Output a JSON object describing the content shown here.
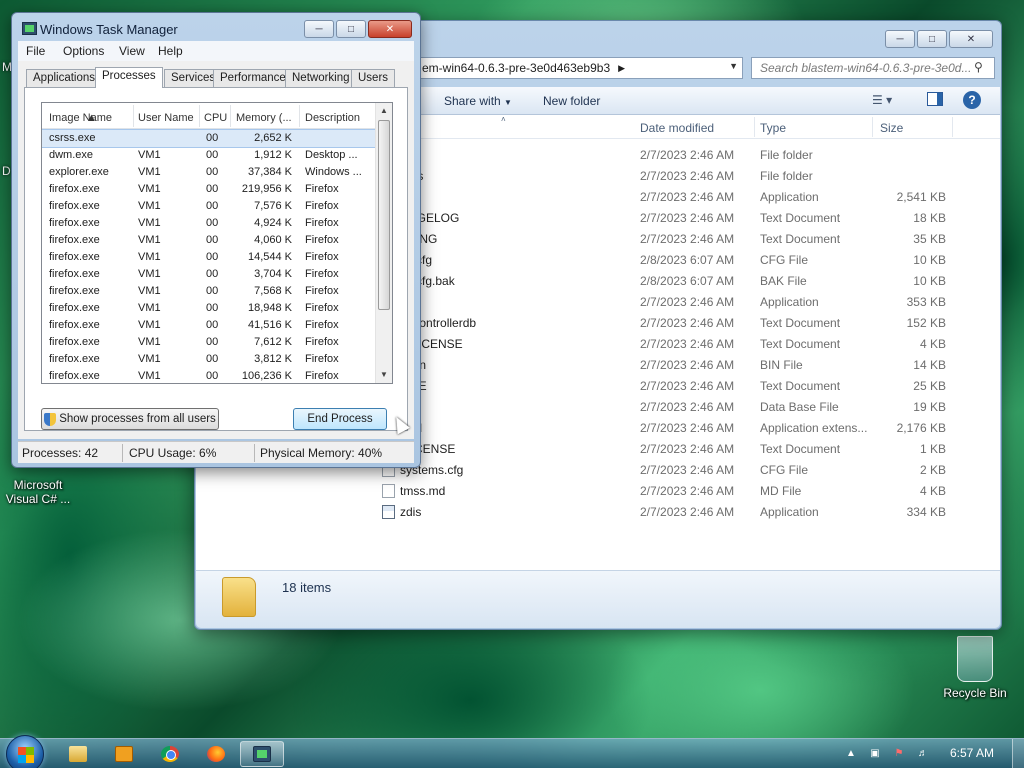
{
  "desktop": {
    "recycle_bin_label": "Recycle Bin",
    "vs_icon_label_line1": "Microsoft",
    "vs_icon_label_line2": "Visual C# ...",
    "edge_label_1": "M",
    "edge_label_2": "D"
  },
  "explorer": {
    "address_text": "em-win64-0.6.3-pre-3e0d463eb9b3",
    "search_placeholder": "Search blastem-win64-0.6.3-pre-3e0d...",
    "toolbar": {
      "share_with": "Share with",
      "new_folder": "New folder"
    },
    "columns": {
      "date": "Date modified",
      "type": "Type",
      "size": "Size"
    },
    "files": [
      {
        "name": "ges",
        "date": "2/7/2023 2:46 AM",
        "type": "File folder",
        "size": ""
      },
      {
        "name": "ders",
        "date": "2/7/2023 2:46 AM",
        "type": "File folder",
        "size": ""
      },
      {
        "name": "tem",
        "date": "2/7/2023 2:46 AM",
        "type": "Application",
        "size": "2,541 KB"
      },
      {
        "name": "ANGELOG",
        "date": "2/7/2023 2:46 AM",
        "type": "Text Document",
        "size": "18 KB"
      },
      {
        "name": "PYING",
        "date": "2/7/2023 2:46 AM",
        "type": "Text Document",
        "size": "35 KB"
      },
      {
        "name": "ult.cfg",
        "date": "2/8/2023 6:07 AM",
        "type": "CFG File",
        "size": "10 KB"
      },
      {
        "name": "ult.cfg.bak",
        "date": "2/8/2023 6:07 AM",
        "type": "BAK File",
        "size": "10 KB"
      },
      {
        "name": "",
        "date": "2/7/2023 2:46 AM",
        "type": "Application",
        "size": "353 KB"
      },
      {
        "name": "necontrollerdb",
        "date": "2/7/2023 2:46 AM",
        "type": "Text Document",
        "size": "152 KB"
      },
      {
        "name": "V-LICENSE",
        "date": "2/7/2023 2:46 AM",
        "type": "Text Document",
        "size": "4 KB"
      },
      {
        "name": "u.bin",
        "date": "2/7/2023 2:46 AM",
        "type": "BIN File",
        "size": "14 KB"
      },
      {
        "name": "DME",
        "date": "2/7/2023 2:46 AM",
        "type": "Text Document",
        "size": "25 KB"
      },
      {
        "name": "",
        "date": "2/7/2023 2:46 AM",
        "type": "Data Base File",
        "size": "19 KB"
      },
      {
        "name": "2.dll",
        "date": "2/7/2023 2:46 AM",
        "type": "Application extens...",
        "size": "2,176 KB"
      },
      {
        "name": "-LICENSE",
        "date": "2/7/2023 2:46 AM",
        "type": "Text Document",
        "size": "1 KB"
      },
      {
        "name": "systems.cfg",
        "date": "2/7/2023 2:46 AM",
        "type": "CFG File",
        "size": "2 KB"
      },
      {
        "name": "tmss.md",
        "date": "2/7/2023 2:46 AM",
        "type": "MD File",
        "size": "4 KB"
      },
      {
        "name": "zdis",
        "date": "2/7/2023 2:46 AM",
        "type": "Application",
        "size": "334 KB"
      }
    ],
    "item_count": "18 items"
  },
  "taskmgr": {
    "title": "Windows Task Manager",
    "menu": [
      "File",
      "Options",
      "View",
      "Help"
    ],
    "tabs": [
      "Applications",
      "Processes",
      "Services",
      "Performance",
      "Networking",
      "Users"
    ],
    "active_tab": "Processes",
    "columns": {
      "image": "Image Name",
      "user": "User Name",
      "cpu": "CPU",
      "memory": "Memory (...",
      "desc": "Description"
    },
    "processes": [
      {
        "image": "csrss.exe",
        "user": "",
        "cpu": "00",
        "memory": "2,652 K",
        "desc": ""
      },
      {
        "image": "dwm.exe",
        "user": "VM1",
        "cpu": "00",
        "memory": "1,912 K",
        "desc": "Desktop ..."
      },
      {
        "image": "explorer.exe",
        "user": "VM1",
        "cpu": "00",
        "memory": "37,384 K",
        "desc": "Windows ..."
      },
      {
        "image": "firefox.exe",
        "user": "VM1",
        "cpu": "00",
        "memory": "219,956 K",
        "desc": "Firefox"
      },
      {
        "image": "firefox.exe",
        "user": "VM1",
        "cpu": "00",
        "memory": "7,576 K",
        "desc": "Firefox"
      },
      {
        "image": "firefox.exe",
        "user": "VM1",
        "cpu": "00",
        "memory": "4,924 K",
        "desc": "Firefox"
      },
      {
        "image": "firefox.exe",
        "user": "VM1",
        "cpu": "00",
        "memory": "4,060 K",
        "desc": "Firefox"
      },
      {
        "image": "firefox.exe",
        "user": "VM1",
        "cpu": "00",
        "memory": "14,544 K",
        "desc": "Firefox"
      },
      {
        "image": "firefox.exe",
        "user": "VM1",
        "cpu": "00",
        "memory": "3,704 K",
        "desc": "Firefox"
      },
      {
        "image": "firefox.exe",
        "user": "VM1",
        "cpu": "00",
        "memory": "7,568 K",
        "desc": "Firefox"
      },
      {
        "image": "firefox.exe",
        "user": "VM1",
        "cpu": "00",
        "memory": "18,948 K",
        "desc": "Firefox"
      },
      {
        "image": "firefox.exe",
        "user": "VM1",
        "cpu": "00",
        "memory": "41,516 K",
        "desc": "Firefox"
      },
      {
        "image": "firefox.exe",
        "user": "VM1",
        "cpu": "00",
        "memory": "7,612 K",
        "desc": "Firefox"
      },
      {
        "image": "firefox.exe",
        "user": "VM1",
        "cpu": "00",
        "memory": "3,812 K",
        "desc": "Firefox"
      },
      {
        "image": "firefox.exe",
        "user": "VM1",
        "cpu": "00",
        "memory": "106,236 K",
        "desc": "Firefox"
      }
    ],
    "buttons": {
      "show_all": "Show processes from all users",
      "end_process": "End Process"
    },
    "status": {
      "processes": "Processes: 42",
      "cpu": "CPU Usage: 6%",
      "memory": "Physical Memory: 40%"
    }
  },
  "taskbar": {
    "pinned": [
      "explorer-icon",
      "media-player-icon",
      "chrome-icon",
      "firefox-icon",
      "task-manager-icon"
    ],
    "clock": "6:57 AM"
  },
  "colors": {
    "selection": "#dbe9f8",
    "accent": "#2a64a8"
  }
}
